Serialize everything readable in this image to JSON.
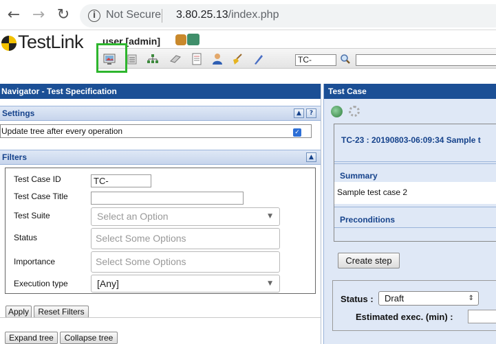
{
  "browser": {
    "back_icon": "arrow-left-icon",
    "forward_icon": "arrow-right-icon",
    "reload_icon": "reload-icon",
    "info_icon": "info-icon",
    "security_text": "Not Secure",
    "url_host": "3.80.25.13",
    "url_path": "/index.php"
  },
  "header": {
    "logo_text": "TestLink",
    "user_label": "user [admin]",
    "tc_search_value": "TC-"
  },
  "navigator": {
    "title": "Navigator - Test Specification",
    "settings": {
      "label": "Settings",
      "update_tree_label": "Update tree after every operation",
      "update_tree_checked": true
    },
    "filters": {
      "label": "Filters",
      "test_case_id_label": "Test Case ID",
      "test_case_id_value": "TC-",
      "test_case_title_label": "Test Case Title",
      "test_case_title_value": "",
      "test_suite_label": "Test Suite",
      "test_suite_placeholder": "Select an Option",
      "status_label": "Status",
      "status_placeholder": "Select Some Options",
      "importance_label": "Importance",
      "importance_placeholder": "Select Some Options",
      "execution_type_label": "Execution type",
      "execution_type_value": "[Any]"
    },
    "apply_label": "Apply",
    "reset_label": "Reset Filters",
    "expand_label": "Expand tree",
    "collapse_label": "Collapse tree"
  },
  "test_case": {
    "title": "Test Case",
    "case_heading": "TC-23 : 20190803-06:09:34 Sample t",
    "summary_label": "Summary",
    "summary_text": "Sample test case 2",
    "preconditions_label": "Preconditions",
    "create_step_label": "Create step",
    "status_label": "Status :",
    "status_value": "Draft",
    "estimated_label": "Estimated exec. (min) :"
  }
}
